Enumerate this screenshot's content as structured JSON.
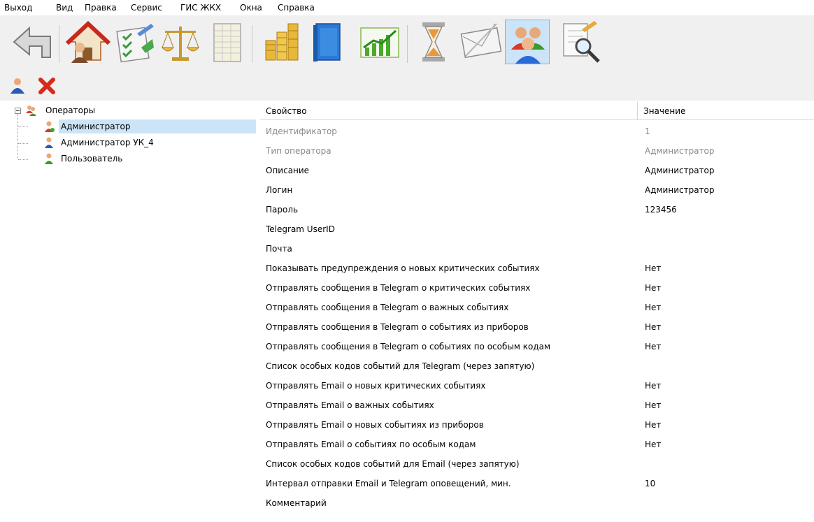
{
  "menu": [
    "Выход",
    "Вид",
    "Правка",
    "Сервис",
    "ГИС ЖКХ",
    "Окна",
    "Справка"
  ],
  "toolbar": {
    "buttons": [
      {
        "icon": "back-arrow-icon"
      },
      {
        "icon": "house-with-user-icon"
      },
      {
        "icon": "checklist-icon"
      },
      {
        "icon": "scales-icon"
      },
      {
        "icon": "spreadsheet-icon"
      },
      {
        "icon": "coins-icon"
      },
      {
        "icon": "book-icon"
      },
      {
        "icon": "growth-chart-icon"
      },
      {
        "icon": "hourglass-icon"
      },
      {
        "icon": "envelope-icon"
      },
      {
        "icon": "users-group-icon",
        "active": true
      },
      {
        "icon": "document-search-icon"
      }
    ],
    "small_buttons": [
      {
        "icon": "add-user-icon"
      },
      {
        "icon": "delete-x-icon"
      }
    ]
  },
  "tree": {
    "root": "Операторы",
    "children": [
      "Администратор",
      "Администратор УК_4",
      "Пользователь"
    ],
    "selected_index": 0
  },
  "grid": {
    "headers": [
      "Свойство",
      "Значение"
    ],
    "rows": [
      {
        "k": "Идентификатор",
        "v": "1",
        "readonly": true
      },
      {
        "k": "Тип оператора",
        "v": "Администратор",
        "readonly": true
      },
      {
        "k": "Описание",
        "v": "Администратор"
      },
      {
        "k": "Логин",
        "v": "Администратор"
      },
      {
        "k": "Пароль",
        "v": "123456"
      },
      {
        "k": "Telegram UserID",
        "v": ""
      },
      {
        "k": "Почта",
        "v": ""
      },
      {
        "k": "Показывать предупреждения о новых критических событиях",
        "v": "Нет"
      },
      {
        "k": "Отправлять сообщения в Telegram о критических событиях",
        "v": "Нет"
      },
      {
        "k": "Отправлять сообщения в Telegram о важных событиях",
        "v": "Нет"
      },
      {
        "k": "Отправлять сообщения в Telegram о событиях из приборов",
        "v": "Нет"
      },
      {
        "k": "Отправлять сообщения в Telegram о событиях по особым кодам",
        "v": "Нет"
      },
      {
        "k": "Список особых кодов событий для Telegram (через запятую)",
        "v": ""
      },
      {
        "k": "Отправлять Email о новых критических событиях",
        "v": "Нет"
      },
      {
        "k": "Отправлять Email о важных событиях",
        "v": "Нет"
      },
      {
        "k": "Отправлять Email о новых событиях из приборов",
        "v": "Нет"
      },
      {
        "k": "Отправлять Email о событиях по особым кодам",
        "v": "Нет"
      },
      {
        "k": "Список особых кодов событий для Email (через запятую)",
        "v": ""
      },
      {
        "k": "Интервал отправки Email и Telegram оповещений, мин.",
        "v": "10"
      },
      {
        "k": "Комментарий",
        "v": ""
      }
    ]
  }
}
